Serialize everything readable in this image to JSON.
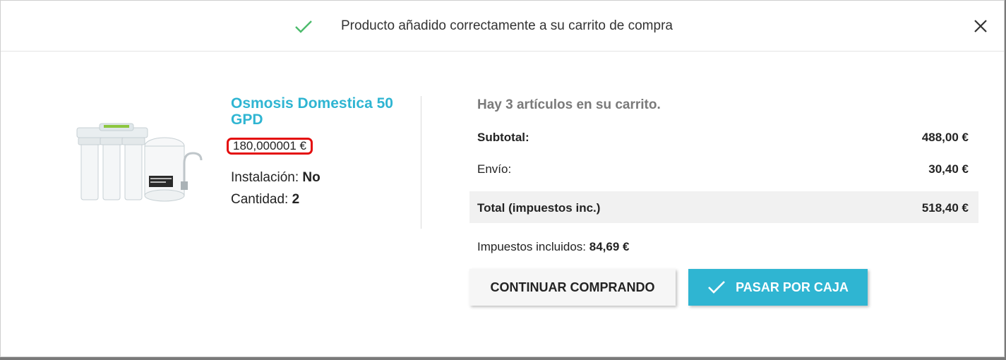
{
  "header": {
    "title": "Producto añadido correctamente a su carrito de compra",
    "check_icon": "check-icon",
    "close_icon": "close-icon"
  },
  "product": {
    "image_icon": "water-filter-image",
    "name": "Osmosis Domestica 50 GPD",
    "price": "180,000001 €",
    "install_label": "Instalación:",
    "install_value": "No",
    "qty_label": "Cantidad:",
    "qty_value": "2"
  },
  "cart": {
    "count_text": "Hay 3 artículos en su carrito.",
    "subtotal_label": "Subtotal:",
    "subtotal_value": "488,00 €",
    "shipping_label": "Envío:",
    "shipping_value": "30,40 €",
    "total_label": "Total (impuestos inc.)",
    "total_value": "518,40 €",
    "tax_label": "Impuestos incluidos:",
    "tax_value": "84,69 €"
  },
  "buttons": {
    "continue_label": "Continuar comprando",
    "checkout_label": "Pasar por caja"
  },
  "colors": {
    "accent": "#2fb5d2",
    "price_highlight": "#e40d0d",
    "success_check": "#4cbb6c"
  }
}
